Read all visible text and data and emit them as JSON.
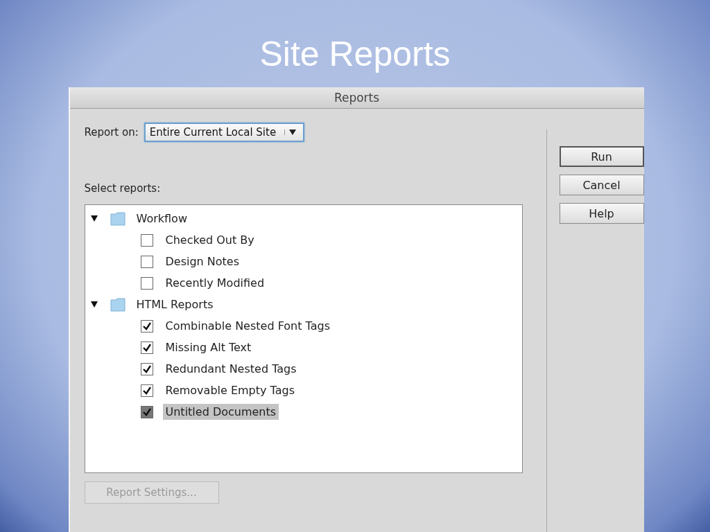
{
  "slide_title": "Site Reports",
  "window": {
    "title": "Reports"
  },
  "report_on": {
    "label": "Report on:",
    "value": "Entire Current Local Site"
  },
  "select_label": "Select reports:",
  "tree": [
    {
      "label": "Workflow",
      "expanded": true,
      "children": [
        {
          "label": "Checked Out By",
          "checked": false,
          "selected": false
        },
        {
          "label": "Design Notes",
          "checked": false,
          "selected": false
        },
        {
          "label": "Recently Modified",
          "checked": false,
          "selected": false
        }
      ]
    },
    {
      "label": "HTML Reports",
      "expanded": true,
      "children": [
        {
          "label": "Combinable Nested Font Tags",
          "checked": true,
          "selected": false
        },
        {
          "label": "Missing Alt Text",
          "checked": true,
          "selected": false
        },
        {
          "label": "Redundant Nested Tags",
          "checked": true,
          "selected": false
        },
        {
          "label": "Removable Empty Tags",
          "checked": true,
          "selected": false
        },
        {
          "label": "Untitled Documents",
          "checked": true,
          "selected": true
        }
      ]
    }
  ],
  "report_settings": {
    "label": "Report Settings...",
    "disabled": true
  },
  "buttons": [
    "Run",
    "Cancel",
    "Help"
  ]
}
